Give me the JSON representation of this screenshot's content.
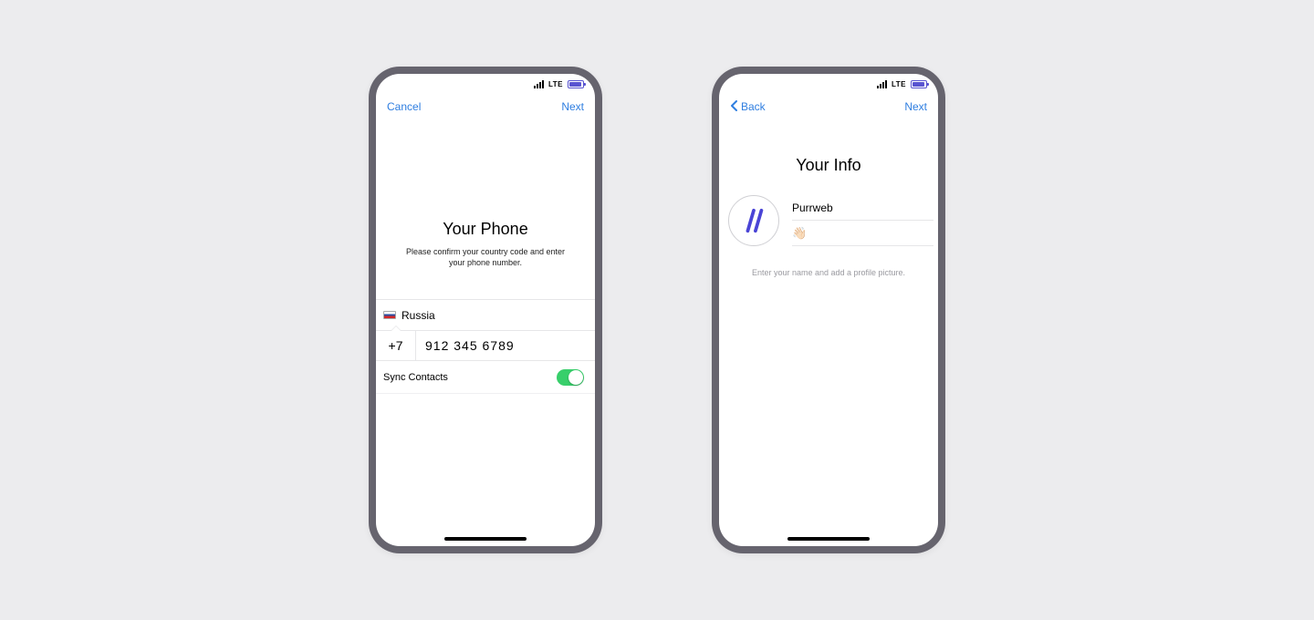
{
  "statusBar": {
    "network": "LTE"
  },
  "colors": {
    "accent": "#2f7ee0",
    "toggleOn": "#38cf6b",
    "battery": "#5954d0"
  },
  "left": {
    "nav": {
      "left": "Cancel",
      "right": "Next"
    },
    "title": "Your Phone",
    "subtitle": "Please confirm your country code and enter your phone number.",
    "country": {
      "name": "Russia",
      "flag": "ru"
    },
    "code": "+7",
    "number": "912 345 6789",
    "syncLabel": "Sync Contacts",
    "syncOn": true
  },
  "right": {
    "nav": {
      "left": "Back",
      "right": "Next"
    },
    "title": "Your Info",
    "name": "Purrweb",
    "lastEmoji": "👋🏻",
    "helper": "Enter your name and add a profile picture."
  }
}
